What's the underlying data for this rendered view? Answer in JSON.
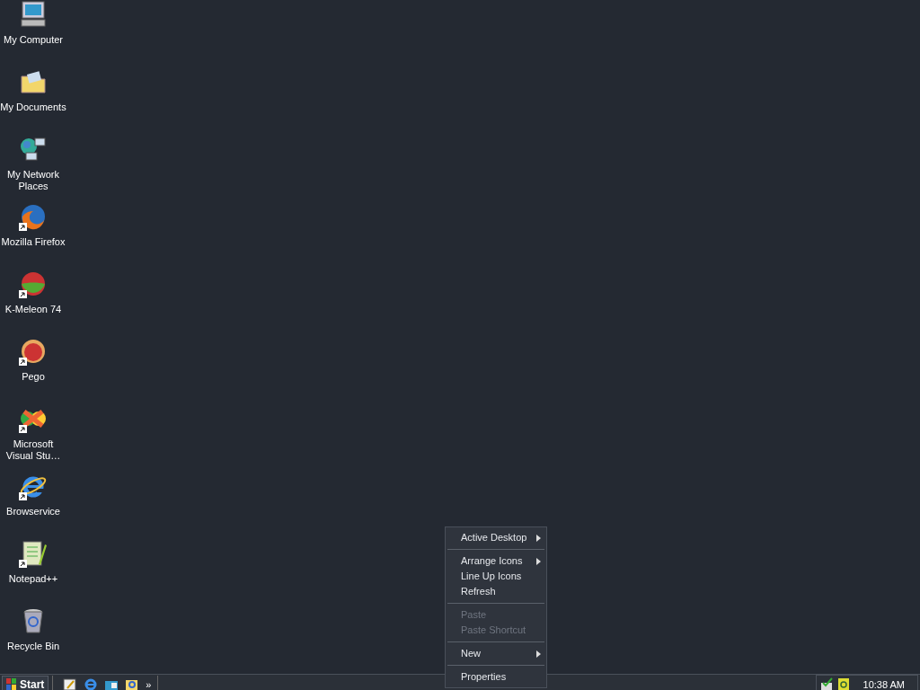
{
  "desktop_icons": [
    {
      "label": "My Computer",
      "kind": "computer",
      "shortcut": false
    },
    {
      "label": "My Documents",
      "kind": "folder",
      "shortcut": false
    },
    {
      "label": "My Network Places",
      "kind": "network",
      "shortcut": false
    },
    {
      "label": "Mozilla Firefox",
      "kind": "firefox",
      "shortcut": true
    },
    {
      "label": "K-Meleon 74",
      "kind": "kmeleon",
      "shortcut": true
    },
    {
      "label": "Pego",
      "kind": "pego",
      "shortcut": true
    },
    {
      "label": "Microsoft Visual Stu…",
      "kind": "studio",
      "shortcut": true
    },
    {
      "label": "Browservice",
      "kind": "ie",
      "shortcut": true
    },
    {
      "label": "Notepad++",
      "kind": "notepad",
      "shortcut": true
    },
    {
      "label": "Recycle Bin",
      "kind": "bin",
      "shortcut": false
    }
  ],
  "context_menu": [
    {
      "kind": "item",
      "label": "Active Desktop",
      "submenu": true,
      "disabled": false
    },
    {
      "kind": "separator"
    },
    {
      "kind": "item",
      "label": "Arrange Icons",
      "submenu": true,
      "disabled": false
    },
    {
      "kind": "item",
      "label": "Line Up Icons",
      "submenu": false,
      "disabled": false
    },
    {
      "kind": "item",
      "label": "Refresh",
      "submenu": false,
      "disabled": false
    },
    {
      "kind": "separator"
    },
    {
      "kind": "item",
      "label": "Paste",
      "submenu": false,
      "disabled": true
    },
    {
      "kind": "item",
      "label": "Paste Shortcut",
      "submenu": false,
      "disabled": true
    },
    {
      "kind": "separator"
    },
    {
      "kind": "item",
      "label": "New",
      "submenu": true,
      "disabled": false
    },
    {
      "kind": "separator"
    },
    {
      "kind": "item",
      "label": "Properties",
      "submenu": false,
      "disabled": false
    }
  ],
  "taskbar": {
    "start_label": "Start",
    "quick_launch": [
      {
        "kind": "desktop"
      },
      {
        "kind": "ie"
      },
      {
        "kind": "outlook"
      },
      {
        "kind": "search"
      }
    ],
    "more": "»",
    "clock": "10:38 AM"
  }
}
